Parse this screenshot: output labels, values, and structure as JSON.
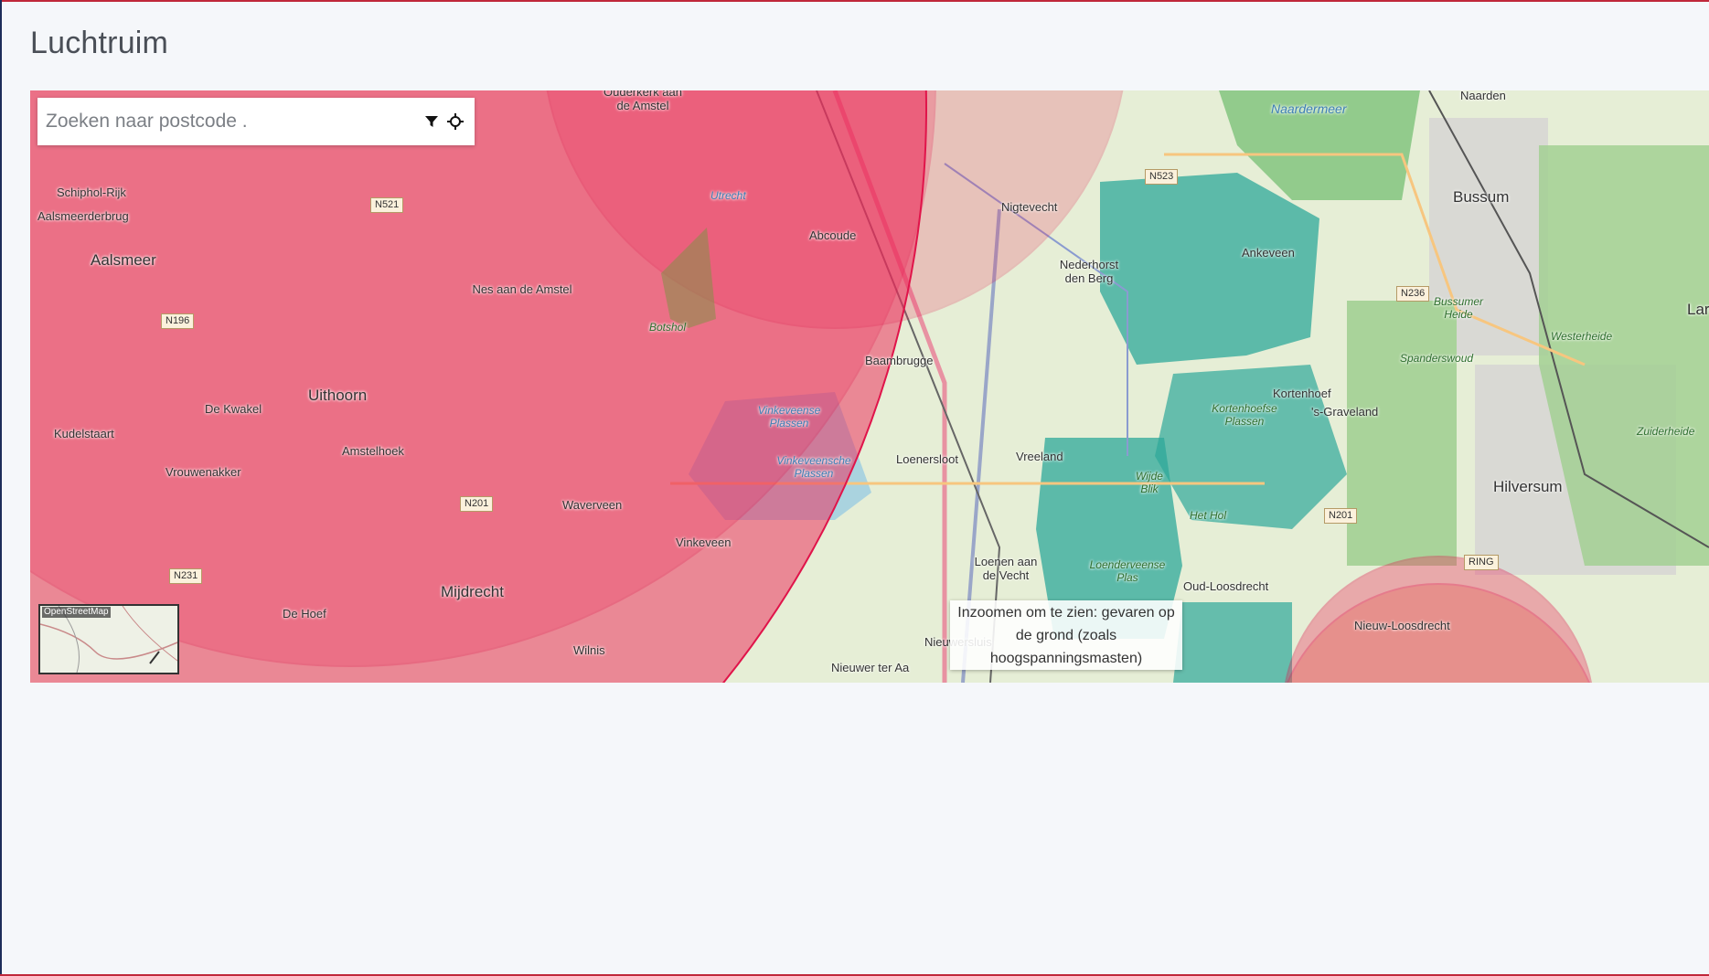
{
  "page": {
    "title": "Luchtruim"
  },
  "search": {
    "placeholder": "Zoeken naar postcode ."
  },
  "icons": {
    "filter": "filter-icon",
    "locate": "crosshair-icon"
  },
  "overview_map": {
    "label": "OpenStreetMap"
  },
  "zoom_hint": "Inzoomen om te zien: gevaren op de grond (zoals hoogspanningsmasten)",
  "colors": {
    "restricted_zone": "#ee2a5b",
    "nature_zone": "#2ea89a",
    "title": "#4a4f57"
  },
  "places": {
    "naarden": "Naarden",
    "naardermeer": "Naardermeer",
    "bussum": "Bussum",
    "schiphol_rijk": "Schiphol-Rijk",
    "aalsmeerderbrug": "Aalsmeerderbrug",
    "aalsmeer": "Aalsmeer",
    "ouderkerk": "Ouderkerk aan de Amstel",
    "utrecht_canal": "Utrecht",
    "nigtevecht": "Nigtevecht",
    "abcoude": "Abcoude",
    "nederhorst": "Nederhorst den Berg",
    "ankeveen": "Ankeveen",
    "laren": "Laren",
    "nes_aan_de_amstel": "Nes aan de Amstel",
    "botshol": "Botshol",
    "baambrugge": "Baambrugge",
    "bussumer_heide": "Bussumer Heide",
    "westerheide": "Westerheide",
    "spanderswoud": "Spanderswoud",
    "uithoorn": "Uithoorn",
    "de_kwakel": "De Kwakel",
    "kortenhoef": "Kortenhoef",
    "s_graveland": "'s-Graveland",
    "kortenhoefse_plassen": "Kortenhoefse Plassen",
    "vinkeveense_plassen_1": "Vinkeveense Plassen",
    "vinkeveense_plassen_2": "Vinkeveensche Plassen",
    "kudelstaart": "Kudelstaart",
    "amstelhoek": "Amstelhoek",
    "vrouwenakker": "Vrouwenakker",
    "loenersloot": "Loenersloot",
    "vreeland": "Vreeland",
    "wijde_blik": "Wijde Blik",
    "zuiderheide": "Zuiderheide",
    "hilversum": "Hilversum",
    "waverveen": "Waverveen",
    "het_hol": "Het Hol",
    "vinkeveen": "Vinkeveen",
    "loenen": "Loenen aan de Vecht",
    "loenderveen": "Loenderveense Plas",
    "oud_loosdrecht": "Oud-Loosdrecht",
    "mijdrecht": "Mijdrecht",
    "de_hoef": "De Hoef",
    "nieuw_loosdrecht": "Nieuw-Loosdrecht",
    "wilnis": "Wilnis",
    "nieuwer_ter_aa": "Nieuwer ter Aa",
    "nieuwersluis": "Nieuwersluis"
  },
  "roads": {
    "n521": "N521",
    "n523": "N523",
    "n196": "N196",
    "n236": "N236",
    "n201_west": "N201",
    "n201_east": "N201",
    "n231": "N231",
    "ring": "RING"
  }
}
